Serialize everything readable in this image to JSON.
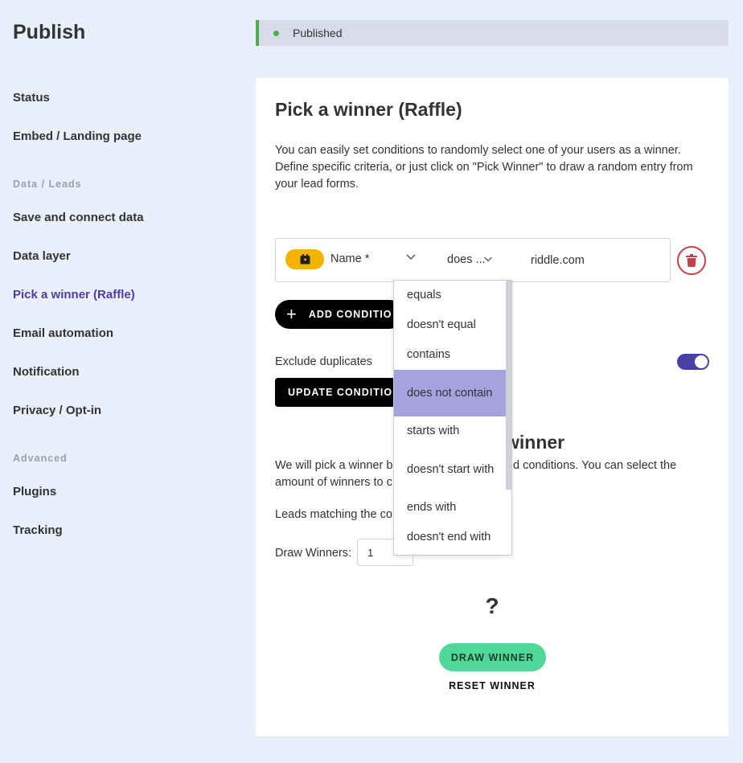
{
  "sidebar": {
    "title": "Publish",
    "items": [
      {
        "label": "Status"
      },
      {
        "label": "Embed / Landing page"
      },
      {
        "label": "Save and connect data"
      },
      {
        "label": "Data layer"
      },
      {
        "label": "Pick a winner (Raffle)",
        "active": true
      },
      {
        "label": "Email automation"
      },
      {
        "label": "Notification"
      },
      {
        "label": "Privacy / Opt-in"
      },
      {
        "label": "Plugins"
      },
      {
        "label": "Tracking"
      }
    ],
    "sections": {
      "data": "Data / Leads",
      "advanced": "Advanced"
    }
  },
  "status": {
    "text": "Published",
    "color": "#4caf50"
  },
  "card": {
    "title": "Pick a winner (Raffle)",
    "description": "You can easily set conditions to randomly select one of your users as a winner. Define specific criteria, or just click on \"Pick Winner\" to draw a random entry from your lead forms.",
    "condition": {
      "field_icon": "calendar-icon",
      "field": "Name *",
      "operator": "does ...",
      "value": "riddle.com"
    },
    "add_condition_label": "ADD CONDITIO",
    "exclude_duplicates_label": "Exclude duplicates",
    "exclude_duplicates_on": true,
    "update_label": "UPDATE CONDITIO",
    "winner_heading": "winner",
    "winner_desc_a": "We will pick a winner b",
    "winner_desc_b": "d conditions. You can select the",
    "winner_desc_c": "amount of winners to c",
    "leads_label": "Leads matching the co",
    "draw_winners_label": "Draw Winners:",
    "draw_winners_value": "1",
    "result": "?",
    "draw_button": "DRAW WINNER",
    "reset_button": "RESET WINNER"
  },
  "dropdown": {
    "options": [
      "equals",
      "doesn't equal",
      "contains",
      "does not contain",
      "starts with",
      "doesn't start with",
      "ends with",
      "doesn't end with"
    ],
    "selected": "does not contain"
  },
  "colors": {
    "accent": "#4a3fa8",
    "chip": "#f2b400",
    "delete": "#c0414b",
    "draw": "#4fd999",
    "selected": "#a6a2de"
  }
}
